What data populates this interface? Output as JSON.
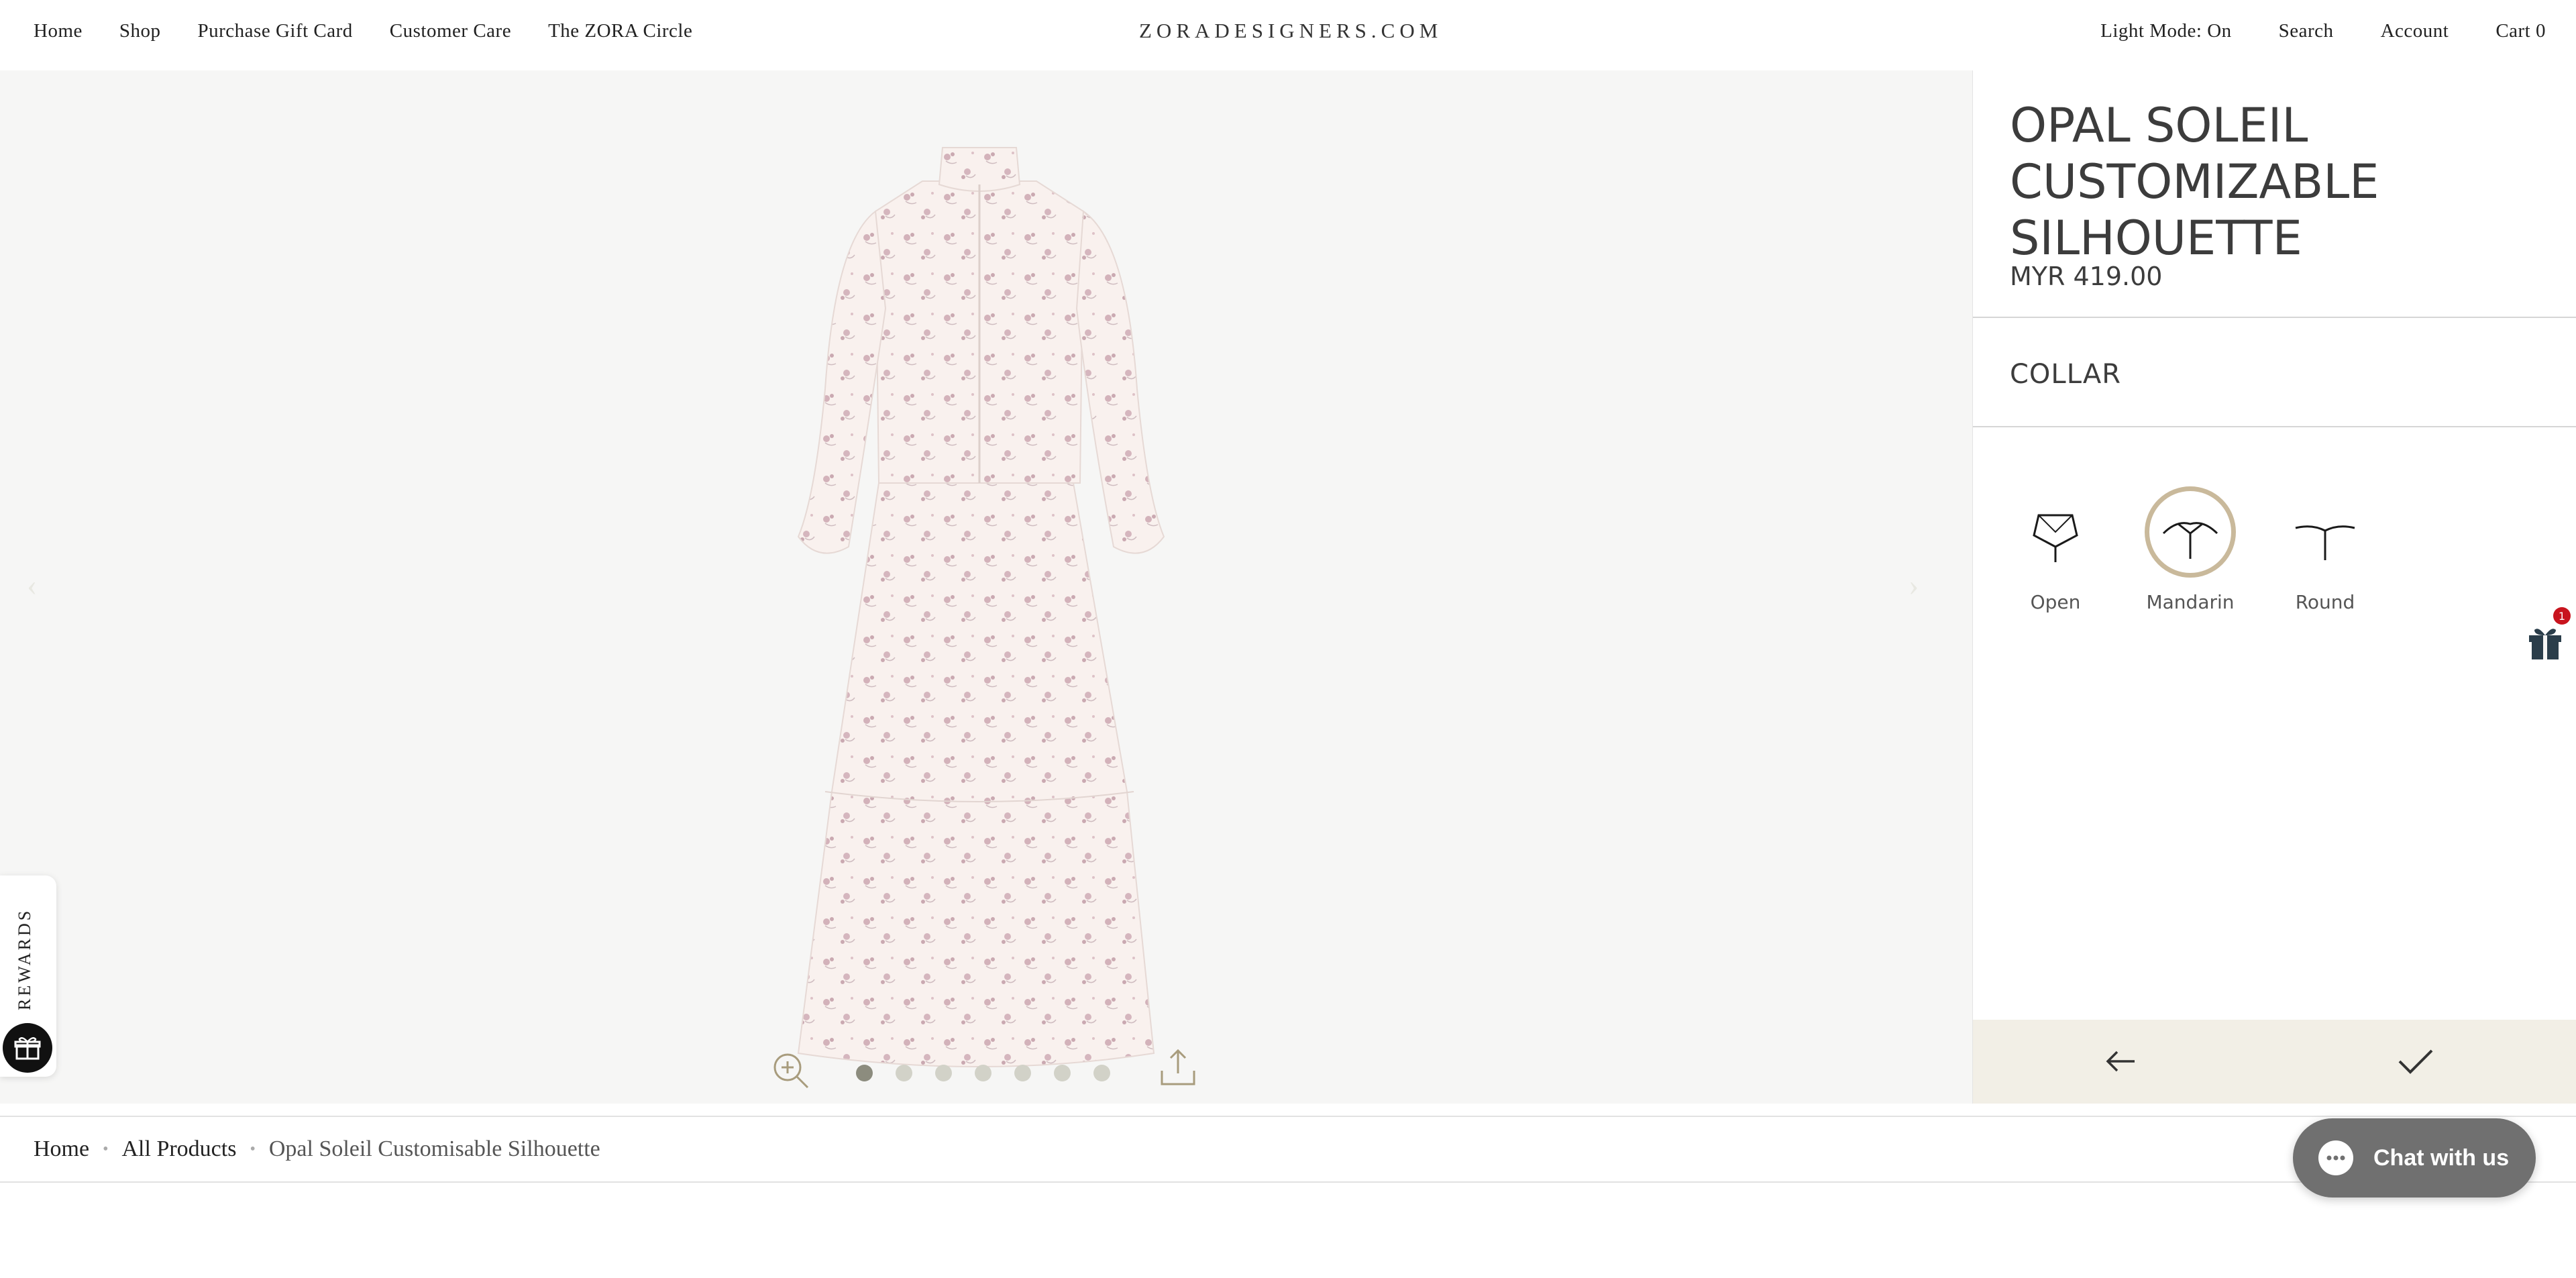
{
  "header": {
    "nav_left": [
      "Home",
      "Shop",
      "Purchase Gift Card",
      "Customer Care",
      "The ZORA Circle"
    ],
    "logo": "ZORADESIGNERS.COM",
    "nav_right": [
      "Light Mode: On",
      "Search",
      "Account",
      "Cart 0"
    ]
  },
  "product": {
    "title": "OPAL SOLEIL CUSTOMIZABLE SILHOUETTE",
    "price": "MYR 419.00",
    "section": "COLLAR",
    "options": [
      "Open",
      "Mandarin",
      "Round"
    ],
    "selected_option": "Mandarin"
  },
  "gallery": {
    "image_count": 7,
    "active_index": 0
  },
  "rewards": {
    "label": "REWARDS"
  },
  "gift_badge": "1",
  "breadcrumb": {
    "home": "Home",
    "all_products": "All Products",
    "current": "Opal Soleil Customisable Silhouette"
  },
  "chat": {
    "label": "Chat with us"
  },
  "colors": {
    "accent_ring": "#c9b99b",
    "footer_bar": "#f2efe6",
    "chat_bg": "#707070"
  }
}
